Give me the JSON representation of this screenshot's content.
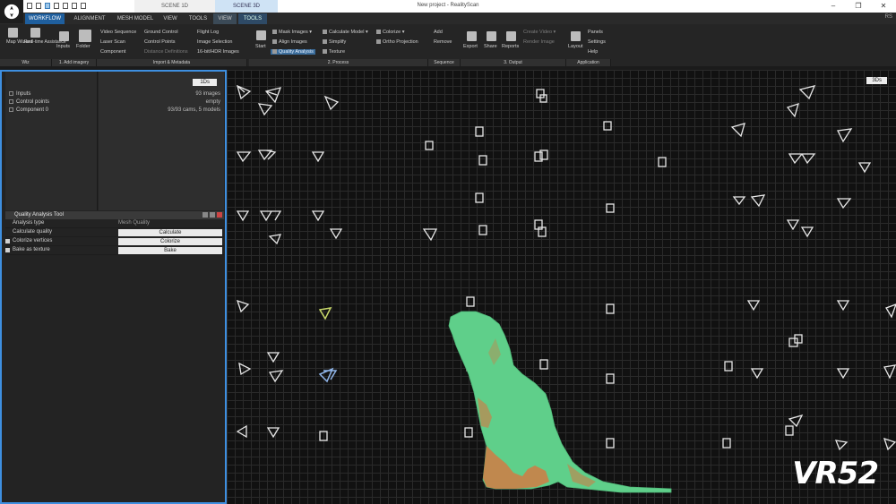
{
  "window": {
    "title": "New project - RealityScan",
    "scene_tabs": [
      "SCENE 1D",
      "SCENE 3D"
    ]
  },
  "menu": {
    "tabs": [
      "WORKFLOW",
      "ALIGNMENT",
      "MESH MODEL",
      "VIEW",
      "TOOLS",
      "VIEW",
      "TOOLS"
    ],
    "right": "RS"
  },
  "ribbon": {
    "wiz": [
      "Map Wizard",
      "Real-time Assistance"
    ],
    "add_imagery": [
      "Inputs",
      "Folder"
    ],
    "import_col1": [
      "Video Sequence",
      "Laser Scan",
      "Component"
    ],
    "import_col2": [
      "Ground Control",
      "Control Points",
      "Distance Definitions"
    ],
    "import_col3": [
      "Flight Log",
      "Image Selection",
      "16-bit/HDR Images"
    ],
    "process_start": "Start",
    "process_col1": [
      "Mask Images",
      "Align Images",
      "Quality Analysis"
    ],
    "process_col2": [
      "Calculate Model",
      "Simplify",
      "Texture"
    ],
    "process_col3": [
      "Colorize",
      "Ortho Projection"
    ],
    "sequence": [
      "Add",
      "Remove"
    ],
    "output": [
      "Export",
      "Share",
      "Reports"
    ],
    "output_extra": [
      "Create Video",
      "Render Image"
    ],
    "application_layout": "Layout",
    "application": [
      "Panels",
      "Settings",
      "Help"
    ],
    "groups": [
      "Wiz",
      "1. Add imagery",
      "Import & Metadata",
      "2. Process",
      "Sequence",
      "3. Output",
      "Application"
    ]
  },
  "left_panel": {
    "view_badge": "1Ds",
    "tree": [
      {
        "label": "Inputs",
        "value": "93 images"
      },
      {
        "label": "Control points",
        "value": "empty"
      },
      {
        "label": "Component 0",
        "value": "93/93 cams, 5 models"
      }
    ],
    "tool": {
      "title": "Quality Analysis Tool",
      "rows": [
        {
          "label": "Analysis type",
          "value": "Mesh Quality",
          "kind": "text"
        },
        {
          "label": "Calculate quality",
          "value": "Calculate",
          "kind": "button"
        },
        {
          "label": "Colorize vertices",
          "value": "Colorize",
          "kind": "button"
        },
        {
          "label": "Bake as texture",
          "value": "Bake",
          "kind": "button"
        }
      ]
    }
  },
  "viewport": {
    "view_badge": "3Ds",
    "model_colors": {
      "quality_good": "#5fcf8a",
      "quality_low": "#e0703a"
    }
  },
  "watermark": "VR52",
  "colors": {
    "accent": "#3e8fe0",
    "active_tab": "#1f5f9e"
  }
}
